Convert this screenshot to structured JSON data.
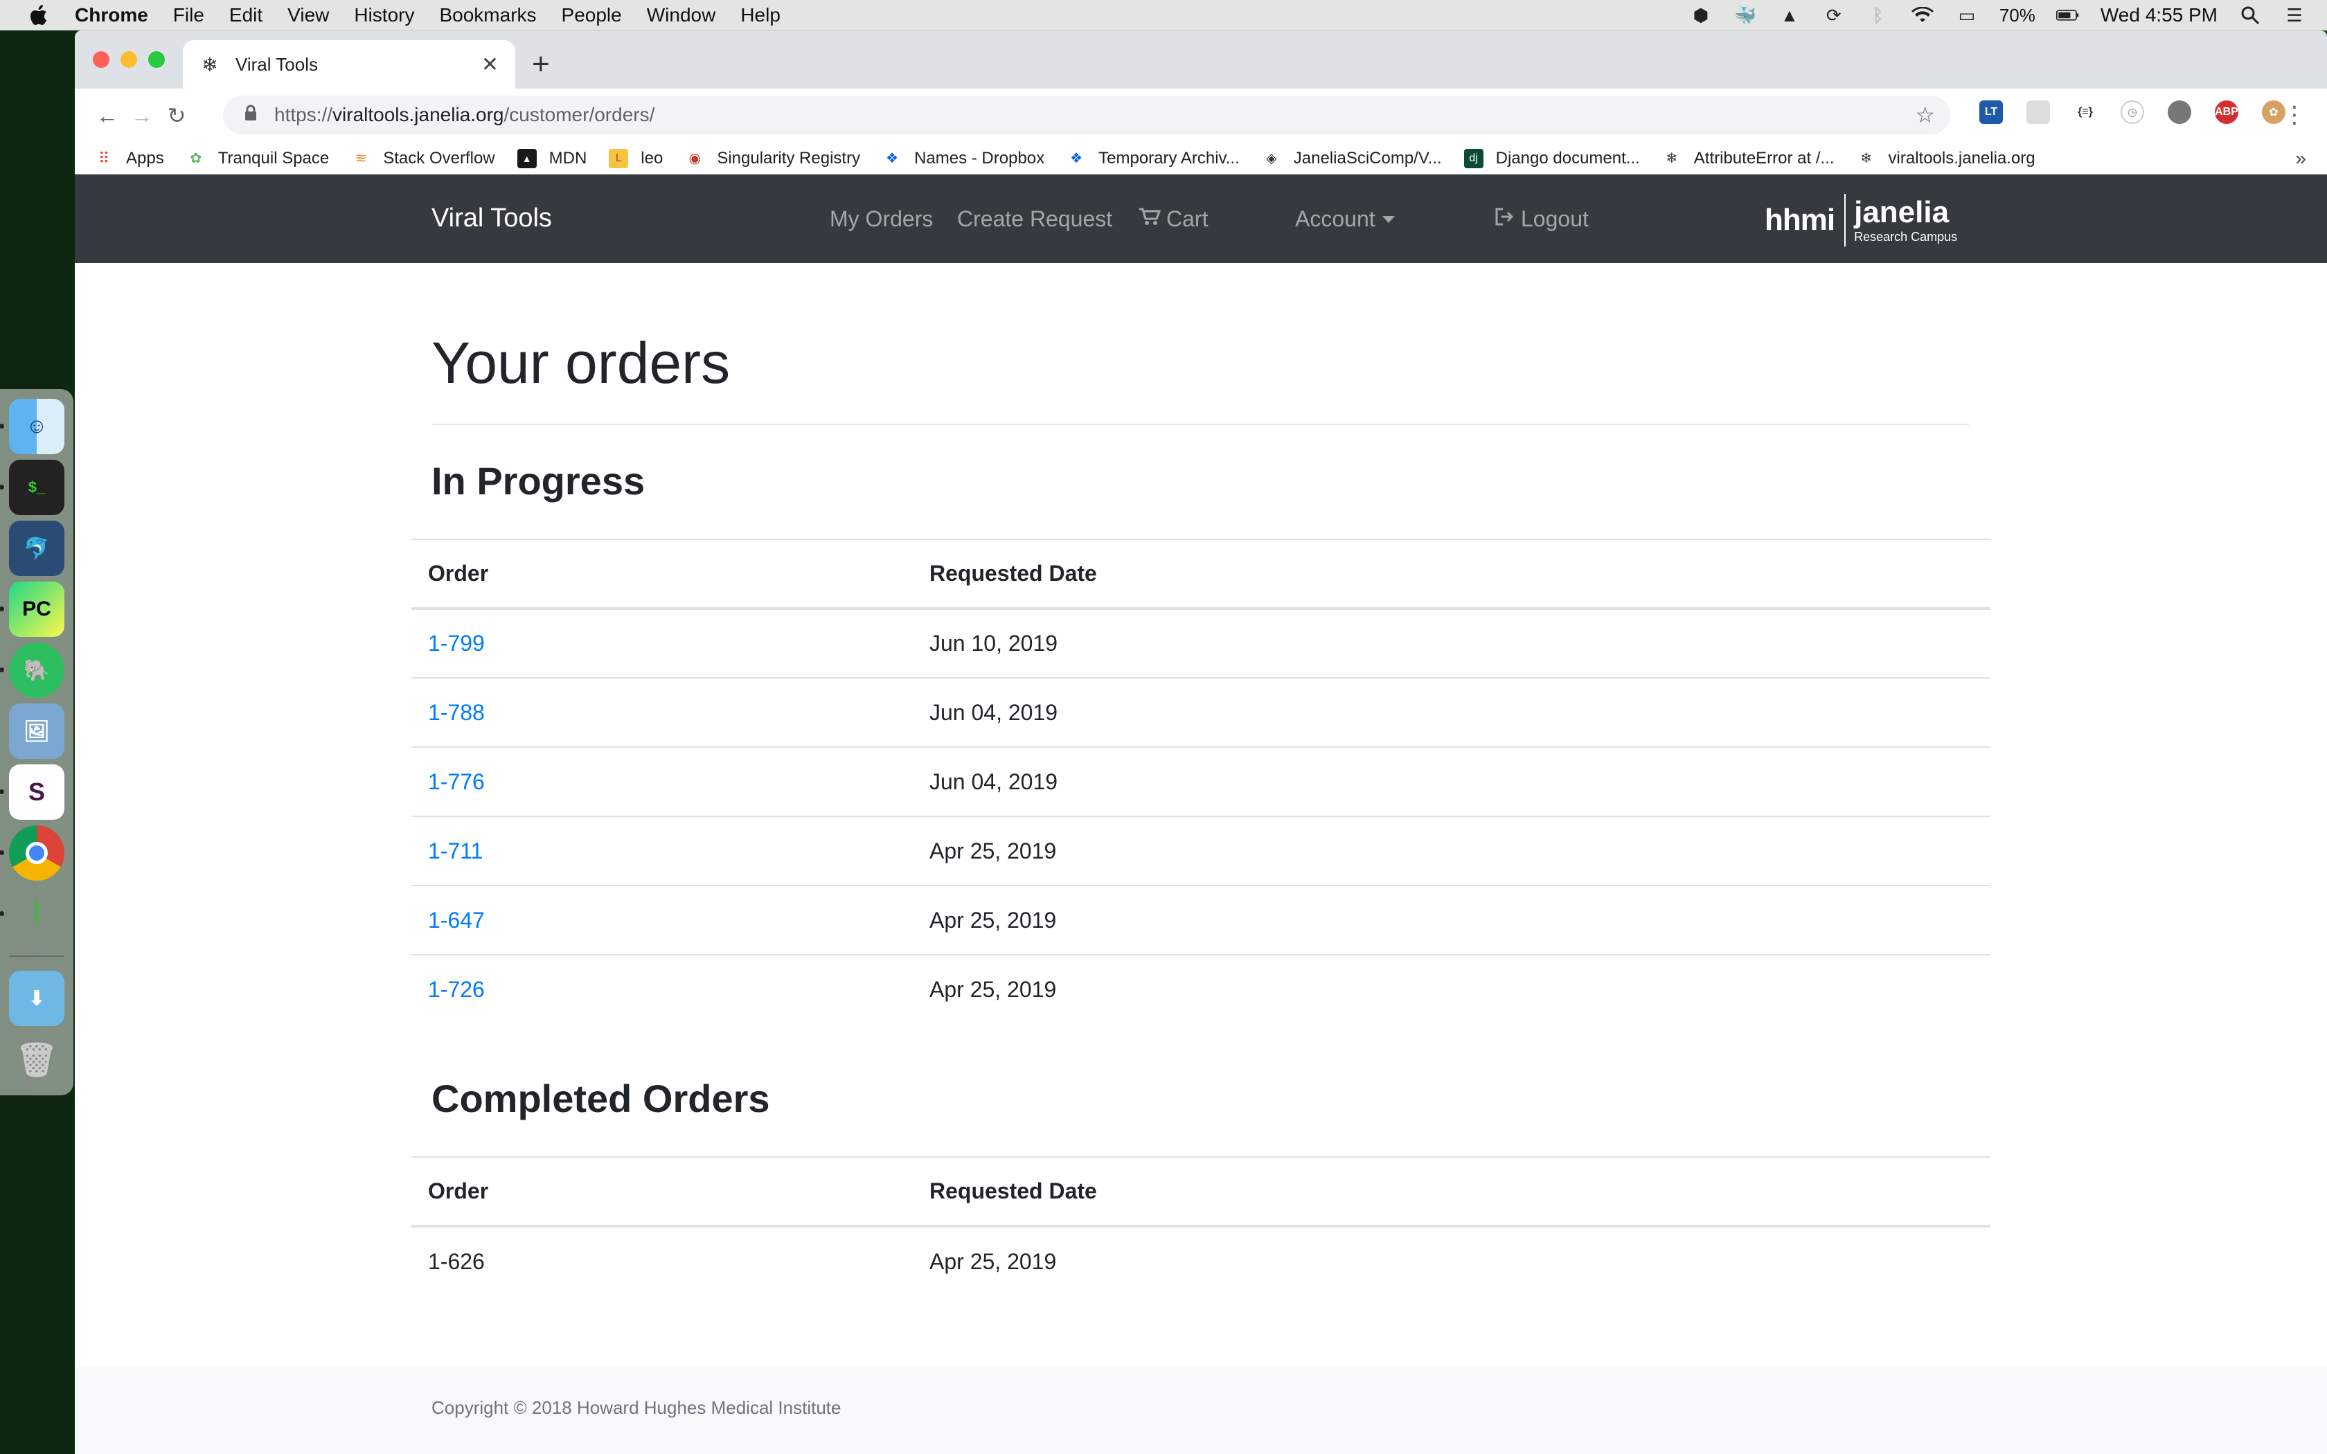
{
  "menubar": {
    "app_name": "Chrome",
    "items": [
      "File",
      "Edit",
      "View",
      "History",
      "Bookmarks",
      "People",
      "Window",
      "Help"
    ],
    "battery": "70%",
    "clock": "Wed 4:55 PM"
  },
  "browser": {
    "tab_title": "Viral Tools",
    "url_scheme": "https://",
    "url_host": "viraltools.janelia.org",
    "url_path": "/customer/orders/",
    "bookmarks": [
      "Apps",
      "Tranquil Space",
      "Stack Overflow",
      "MDN",
      "leo",
      "Singularity Registry",
      "Names - Dropbox",
      "Temporary Archiv...",
      "JaneliaSciComp/V...",
      "Django document...",
      "AttributeError at /...",
      "viraltools.janelia.org"
    ],
    "bookmarks_overflow": "»"
  },
  "navbar": {
    "brand": "Viral Tools",
    "links": {
      "my_orders": "My Orders",
      "create_request": "Create Request",
      "cart": "Cart",
      "account": "Account",
      "logout": "Logout"
    },
    "logo": {
      "hhmi": "hhmi",
      "janelia": "janelia",
      "subtitle": "Research Campus"
    }
  },
  "page": {
    "title": "Your orders",
    "in_progress": {
      "heading": "In Progress",
      "columns": [
        "Order",
        "Requested Date"
      ],
      "rows": [
        {
          "order": "1-799",
          "date": "Jun 10, 2019"
        },
        {
          "order": "1-788",
          "date": "Jun 04, 2019"
        },
        {
          "order": "1-776",
          "date": "Jun 04, 2019"
        },
        {
          "order": "1-711",
          "date": "Apr 25, 2019"
        },
        {
          "order": "1-647",
          "date": "Apr 25, 2019"
        },
        {
          "order": "1-726",
          "date": "Apr 25, 2019"
        }
      ]
    },
    "completed": {
      "heading": "Completed Orders",
      "columns": [
        "Order",
        "Requested Date"
      ],
      "rows": [
        {
          "order": "1-626",
          "date": "Apr 25, 2019"
        }
      ]
    },
    "footer": "Copyright © 2018 Howard Hughes Medical Institute"
  },
  "colors": {
    "navbar_bg": "#343a40",
    "link": "#007bff",
    "footer_bg": "#f8f9fa"
  }
}
